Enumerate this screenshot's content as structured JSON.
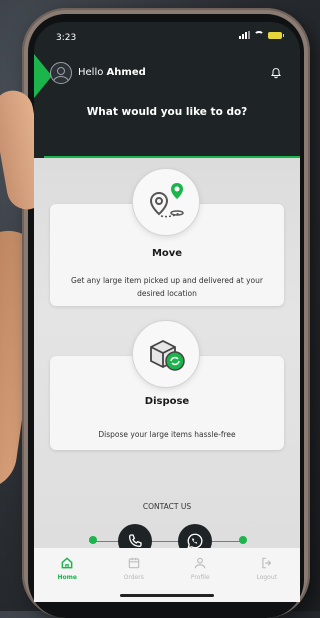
{
  "status_bar": {
    "time": "3:23"
  },
  "header": {
    "greeting_prefix": "Hello",
    "user_name": "Ahmed",
    "question": "What would you like to do?"
  },
  "services": [
    {
      "title": "Move",
      "description": "Get any large item picked up and delivered at your desired location",
      "icon": "location-pins-icon"
    },
    {
      "title": "Dispose",
      "description": "Dispose your large items hassle-free",
      "icon": "recycle-box-icon"
    }
  ],
  "contact": {
    "label": "CONTACT US",
    "phone_icon": "phone-icon",
    "whatsapp_icon": "whatsapp-icon"
  },
  "nav": [
    {
      "label": "Home",
      "icon": "home-icon",
      "active": true
    },
    {
      "label": "Orders",
      "icon": "orders-icon",
      "active": false
    },
    {
      "label": "Profile",
      "icon": "profile-icon",
      "active": false
    },
    {
      "label": "Logout",
      "icon": "logout-icon",
      "active": false
    }
  ],
  "colors": {
    "accent": "#1bb54c",
    "dark": "#1e2326",
    "battery": "#e8d73a"
  }
}
